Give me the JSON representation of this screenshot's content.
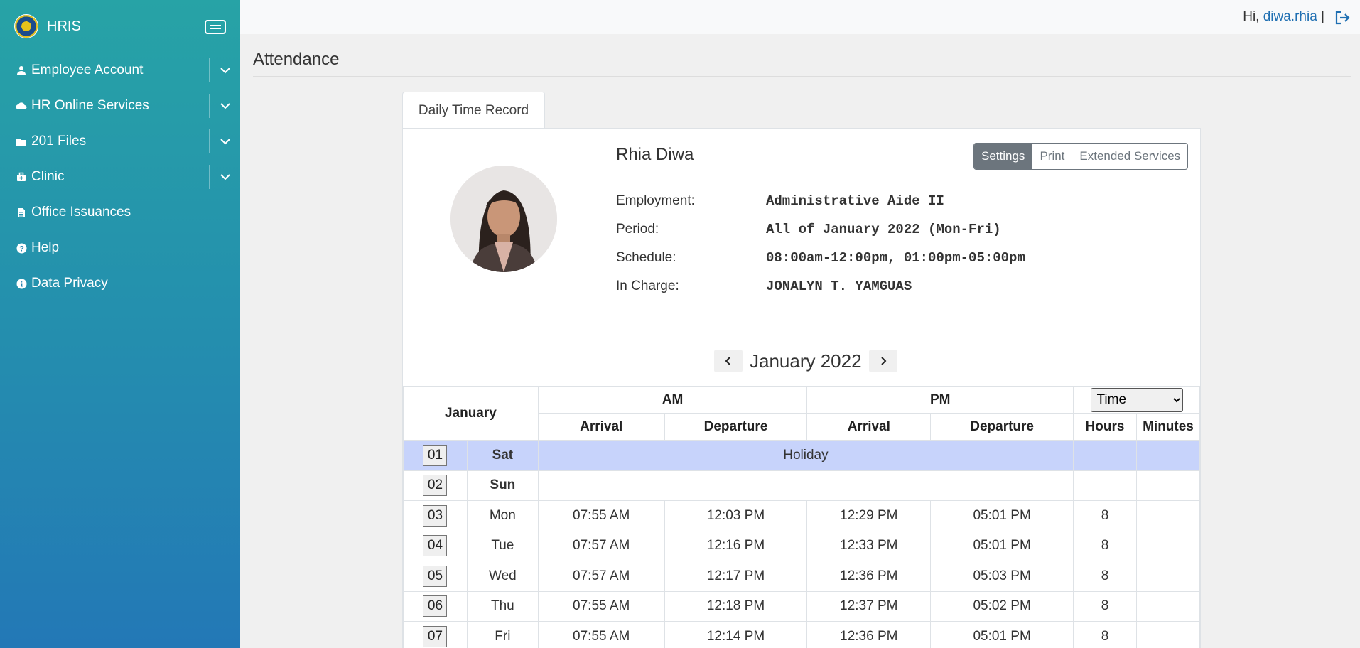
{
  "app": {
    "name": "HRIS"
  },
  "sidebar": {
    "items": [
      {
        "label": "Employee Account",
        "icon": "person-icon",
        "has_submenu": true
      },
      {
        "label": "HR Online Services",
        "icon": "cloud-icon",
        "has_submenu": true
      },
      {
        "label": "201 Files",
        "icon": "folder-icon",
        "has_submenu": true
      },
      {
        "label": "Clinic",
        "icon": "briefcase-medical-icon",
        "has_submenu": true
      },
      {
        "label": "Office Issuances",
        "icon": "file-icon",
        "has_submenu": false
      },
      {
        "label": "Help",
        "icon": "question-circle-icon",
        "has_submenu": false
      },
      {
        "label": "Data Privacy",
        "icon": "info-circle-icon",
        "has_submenu": false
      }
    ]
  },
  "topbar": {
    "greeting": "Hi,",
    "username": "diwa.rhia",
    "separator": "|"
  },
  "page": {
    "title": "Attendance"
  },
  "tabs": {
    "active": "Daily Time Record"
  },
  "employee": {
    "name": "Rhia Diwa",
    "fields": [
      {
        "label": "Employment:",
        "value": "Administrative Aide II"
      },
      {
        "label": "Period:",
        "value": "All of January 2022 (Mon-Fri)"
      },
      {
        "label": "Schedule:",
        "value": "08:00am-12:00pm, 01:00pm-05:00pm"
      },
      {
        "label": "In Charge:",
        "value": "JONALYN T. YAMGUAS"
      }
    ]
  },
  "actions": {
    "settings": "Settings",
    "print": "Print",
    "extended": "Extended Services"
  },
  "calendar": {
    "month_label": "January 2022"
  },
  "table": {
    "month": "January",
    "am": "AM",
    "pm": "PM",
    "select_value": "Time",
    "arrival": "Arrival",
    "departure": "Departure",
    "hours": "Hours",
    "minutes": "Minutes",
    "holiday_row": {
      "day": "01",
      "weekday": "Sat",
      "note": "Holiday"
    },
    "sunday_row": {
      "day": "02",
      "weekday": "Sun"
    },
    "rows": [
      {
        "day": "03",
        "weekday": "Mon",
        "am_in": "07:55 AM",
        "am_out": "12:03 PM",
        "pm_in": "12:29 PM",
        "pm_out": "05:01 PM",
        "hours": "8",
        "minutes": ""
      },
      {
        "day": "04",
        "weekday": "Tue",
        "am_in": "07:57 AM",
        "am_out": "12:16 PM",
        "pm_in": "12:33 PM",
        "pm_out": "05:01 PM",
        "hours": "8",
        "minutes": ""
      },
      {
        "day": "05",
        "weekday": "Wed",
        "am_in": "07:57 AM",
        "am_out": "12:17 PM",
        "pm_in": "12:36 PM",
        "pm_out": "05:03 PM",
        "hours": "8",
        "minutes": ""
      },
      {
        "day": "06",
        "weekday": "Thu",
        "am_in": "07:55 AM",
        "am_out": "12:18 PM",
        "pm_in": "12:37 PM",
        "pm_out": "05:02 PM",
        "hours": "8",
        "minutes": ""
      },
      {
        "day": "07",
        "weekday": "Fri",
        "am_in": "07:55 AM",
        "am_out": "12:14 PM",
        "pm_in": "12:36 PM",
        "pm_out": "05:01 PM",
        "hours": "8",
        "minutes": ""
      }
    ]
  }
}
